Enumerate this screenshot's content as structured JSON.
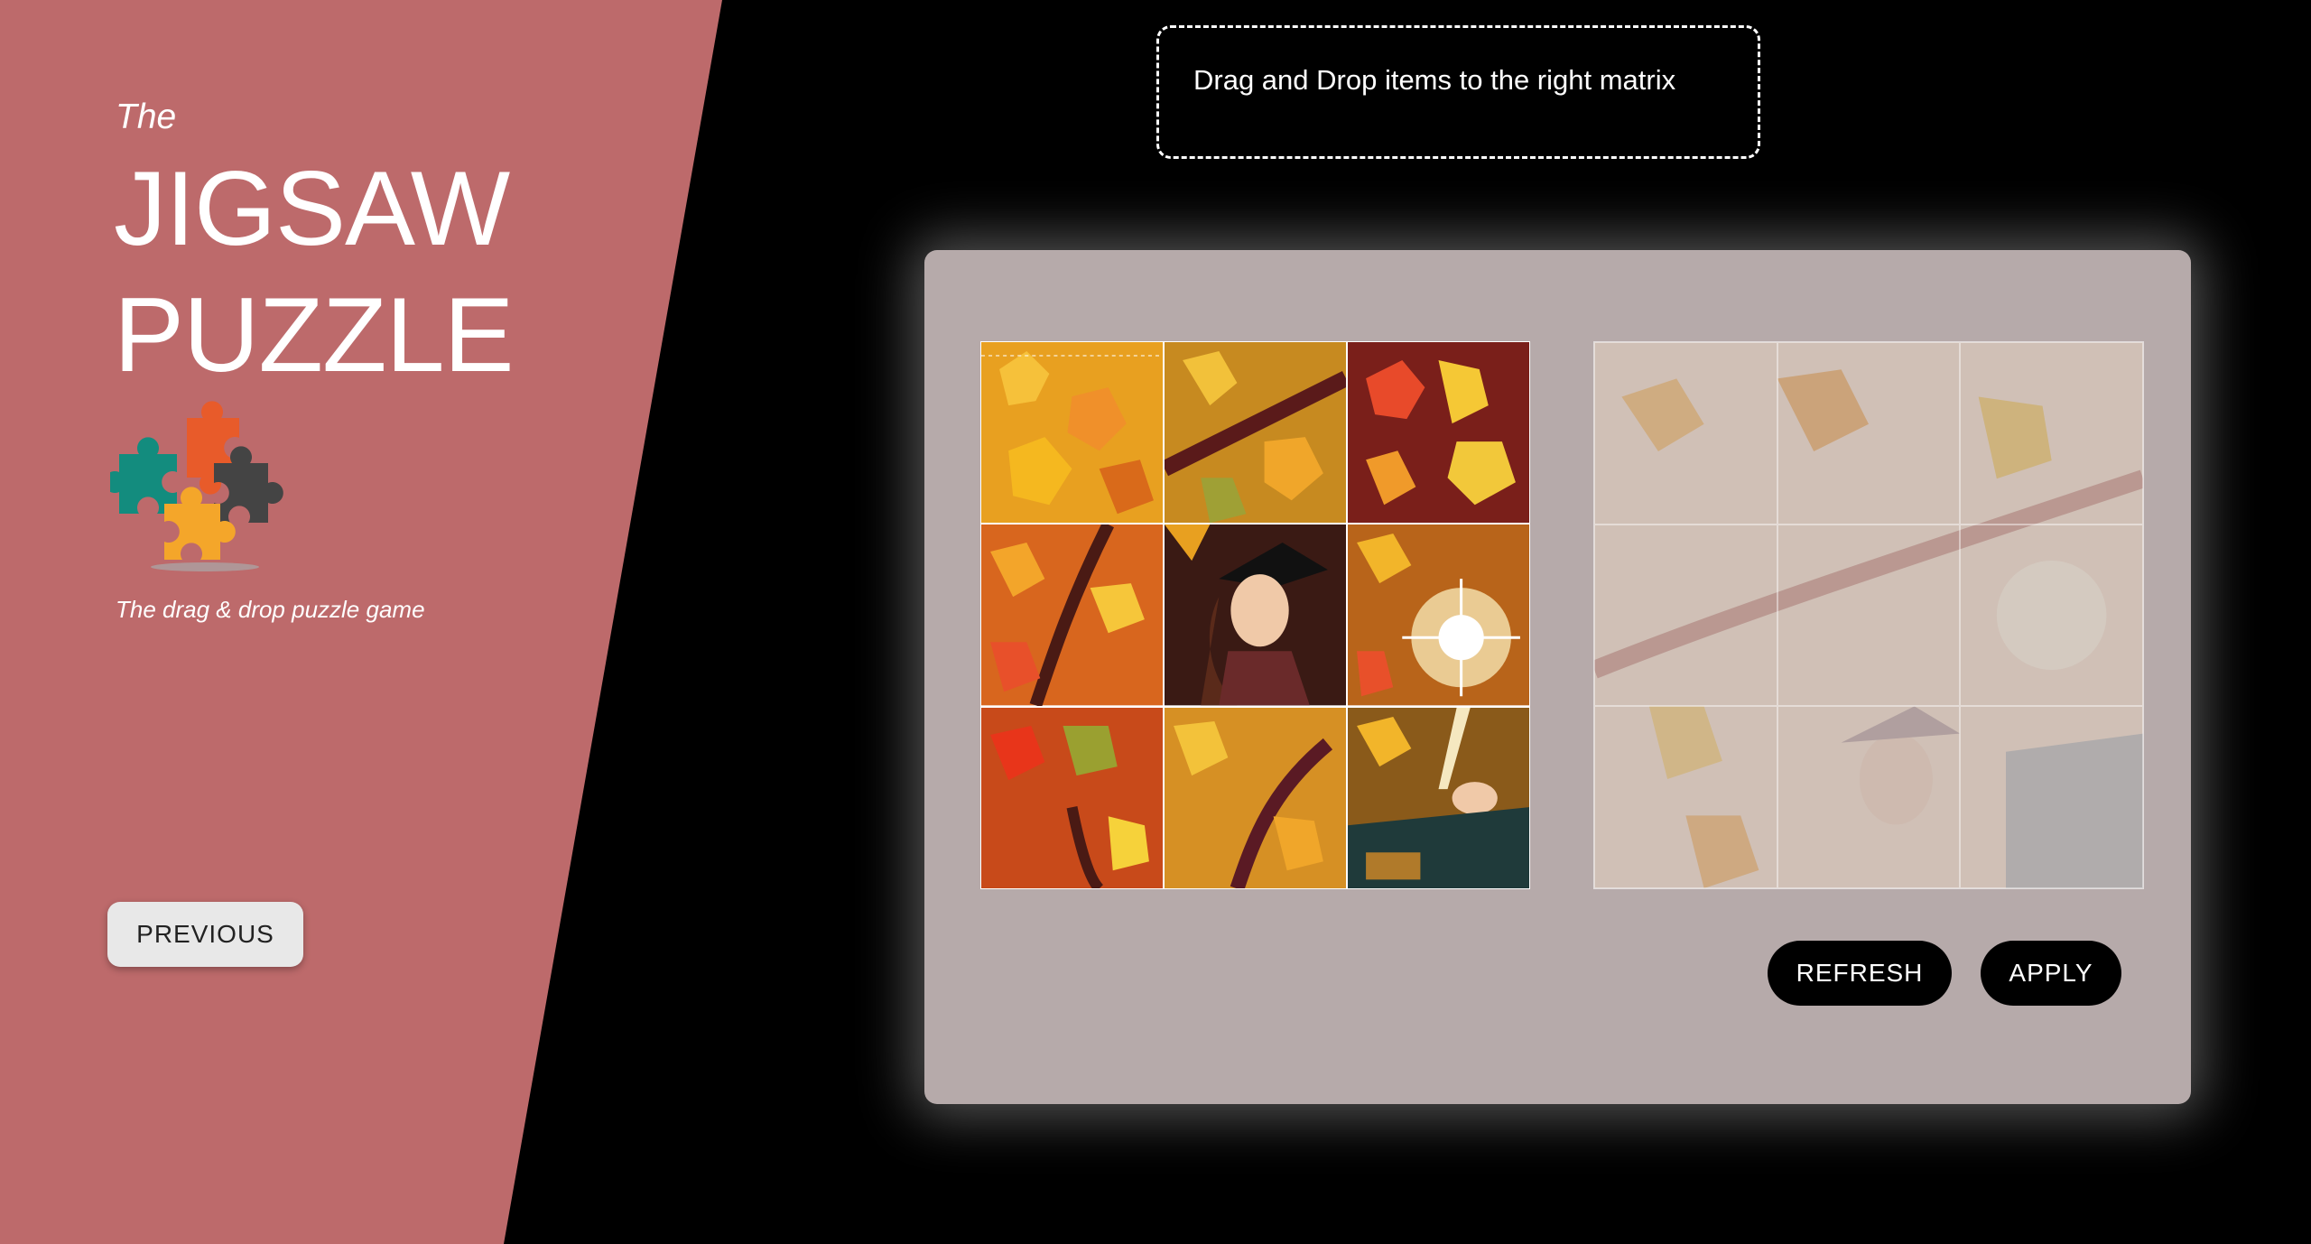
{
  "sidebar": {
    "title_prefix": "The",
    "title_line1": "JIGSAW",
    "title_line2": "PUZZLE",
    "tagline": "The drag & drop puzzle game",
    "previous_label": "PREVIOUS",
    "logo_icon": "jigsaw-pieces-icon"
  },
  "instruction": "Drag and Drop items to the right matrix",
  "board": {
    "pieces": [
      {
        "description": "autumn-leaves-piece-1"
      },
      {
        "description": "autumn-leaves-branch-piece-2"
      },
      {
        "description": "autumn-leaves-dark-piece-3"
      },
      {
        "description": "autumn-leaves-branch-piece-4"
      },
      {
        "description": "witch-girl-face-piece-5"
      },
      {
        "description": "sparkle-light-piece-6"
      },
      {
        "description": "red-leaves-piece-7"
      },
      {
        "description": "branch-leaves-piece-8"
      },
      {
        "description": "hand-wand-house-piece-9"
      }
    ],
    "refresh_label": "REFRESH",
    "apply_label": "APPLY"
  },
  "colors": {
    "sidebar_bg": "#bd6a6b",
    "board_bg": "#b6aaaa",
    "page_bg": "#000000",
    "button_dark": "#000000"
  }
}
